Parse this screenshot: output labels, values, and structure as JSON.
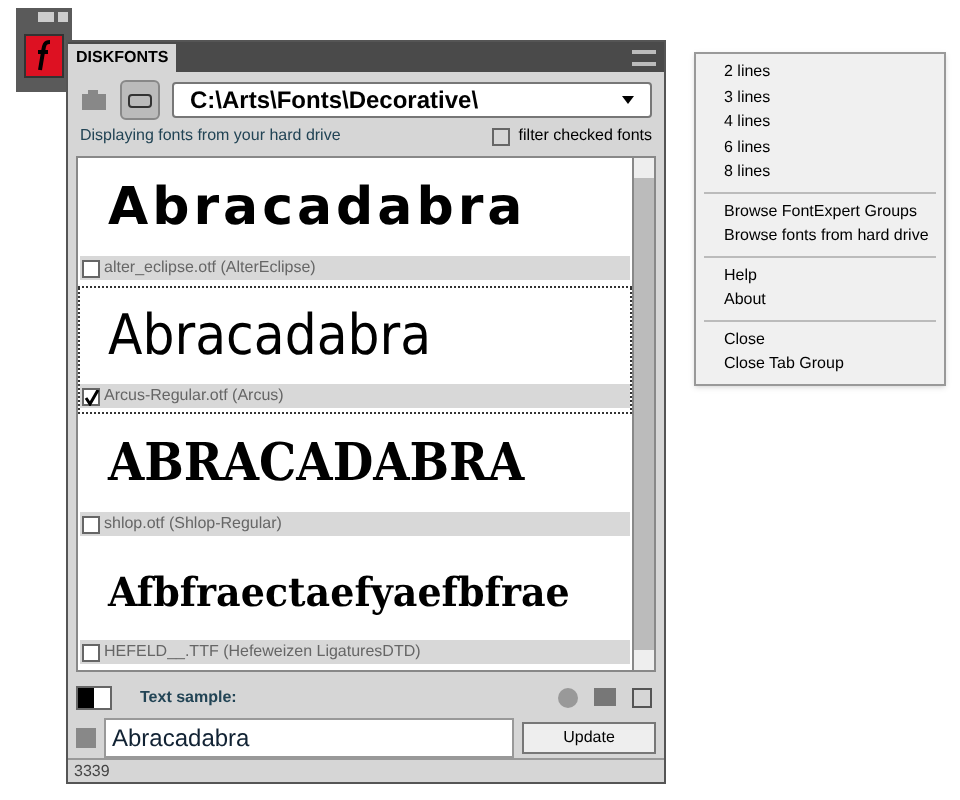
{
  "panel": {
    "title": "DISKFONTS",
    "path": "C:\\Arts\\Fonts\\Decorative\\",
    "info": "Displaying fonts from your hard drive",
    "filter": {
      "label": "filter checked fonts",
      "checked": false
    }
  },
  "fonts": [
    {
      "sample": "Abracadabra",
      "file": "alter_eclipse.otf (AlterEclipse)",
      "checked": false,
      "selected": false,
      "kind": "geometric"
    },
    {
      "sample": "Abracadabra",
      "file": "Arcus-Regular.otf (Arcus)",
      "checked": true,
      "selected": true,
      "kind": "condensed"
    },
    {
      "sample": "ABRACADABRA",
      "file": "shlop.otf (Shlop-Regular)",
      "checked": false,
      "selected": false,
      "kind": "heavy"
    },
    {
      "sample": "Afbfraectaefyaefbfrae",
      "file": "HEFELD__.TTF (Hefeweizen LigaturesDTD)",
      "checked": false,
      "selected": false,
      "kind": "blackletter"
    }
  ],
  "sample": {
    "label": "Text sample:",
    "value": "Abracadabra",
    "button": "Update"
  },
  "status": "3339",
  "menu": [
    [
      "2 lines",
      "3 lines",
      "4 lines",
      "6 lines",
      "8 lines"
    ],
    [
      "Browse FontExpert Groups",
      "Browse fonts from hard drive"
    ],
    [
      "Help",
      "About"
    ],
    [
      "Close",
      "Close Tab Group"
    ]
  ]
}
